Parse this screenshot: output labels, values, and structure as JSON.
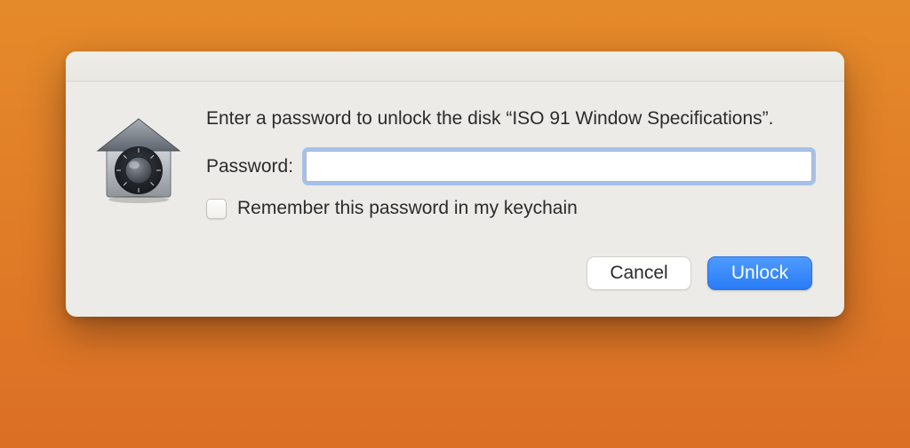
{
  "dialog": {
    "prompt": "Enter a password to unlock the disk “ISO 91 Window Specifications”.",
    "password_label": "Password:",
    "password_value": "",
    "remember_label": "Remember this password in my keychain",
    "remember_checked": false,
    "cancel_label": "Cancel",
    "unlock_label": "Unlock",
    "icon": "filevault-house-lock-icon"
  }
}
